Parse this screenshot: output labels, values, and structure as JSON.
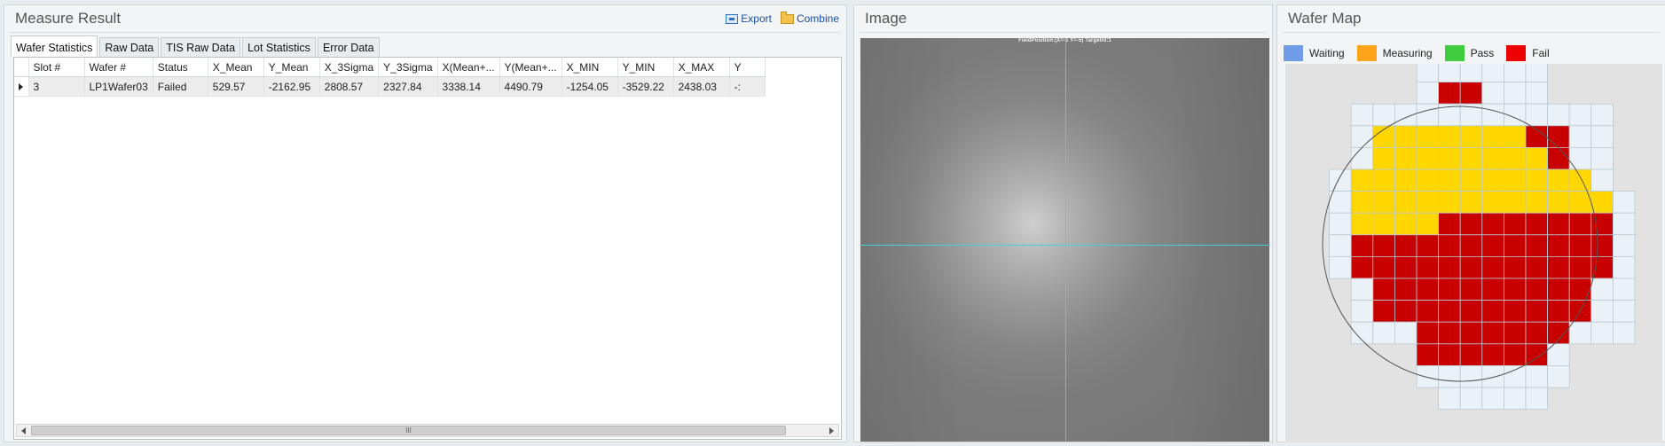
{
  "measure_result": {
    "title": "Measure Result",
    "export_label": "Export",
    "combine_label": "Combine",
    "tabs": [
      {
        "label": "Wafer Statistics",
        "active": true
      },
      {
        "label": "Raw Data",
        "active": false
      },
      {
        "label": "TIS Raw Data",
        "active": false
      },
      {
        "label": "Lot Statistics",
        "active": false
      },
      {
        "label": "Error Data",
        "active": false
      }
    ],
    "columns": [
      "Slot #",
      "Wafer #",
      "Status",
      "X_Mean",
      "Y_Mean",
      "X_3Sigma",
      "Y_3Sigma",
      "X(Mean+...",
      "Y(Mean+...",
      "X_MIN",
      "Y_MIN",
      "X_MAX",
      "Y"
    ],
    "rows": [
      [
        "3",
        "LP1Wafer03",
        "Failed",
        "529.57",
        "-2162.95",
        "2808.57",
        "2327.84",
        "3338.14",
        "4490.79",
        "-1254.05",
        "-3529.22",
        "2438.03",
        "-:"
      ]
    ],
    "scroll_thumb_label": "III"
  },
  "image": {
    "title": "Image",
    "field_position": "FieldPosition:(X=-1 Y=-5) TargetId:1"
  },
  "wafer_map": {
    "title": "Wafer Map",
    "legend": [
      {
        "key": "waiting",
        "label": "Waiting",
        "color": "#6f9be8"
      },
      {
        "key": "measuring",
        "label": "Measuring",
        "color": "#ffa31a"
      },
      {
        "key": "pass",
        "label": "Pass",
        "color": "#3fcd3f"
      },
      {
        "key": "fail",
        "label": "Fail",
        "color": "#ee0000"
      }
    ],
    "colors": {
      "empty": "#eaf2f8",
      "measured_yellow": "#ffd700",
      "measured_red": "#c80000"
    },
    "rows": [
      ".....EEEEEE.....",
      ".....ERREEE.....",
      "..EEEEEEEEEEEE..",
      "..EYYYYYYYRREE..",
      "..EYYYYYYYYREE..",
      ".EYYYYYYYYYYYE..",
      ".EYYYYYYYYYYYYE.",
      ".EYYYYRRRRRRRRE.",
      ".ERRRRRRRRRRRRE.",
      ".ERRRRRRRRRRRRE.",
      "..ERRRRRRRRRREE.",
      "..ERRRRRRRRRREE.",
      "..EEERRRRRRREEE.",
      ".....RRRRRRE....",
      ".....EEEEEEE....",
      "......EEEEE....."
    ]
  }
}
